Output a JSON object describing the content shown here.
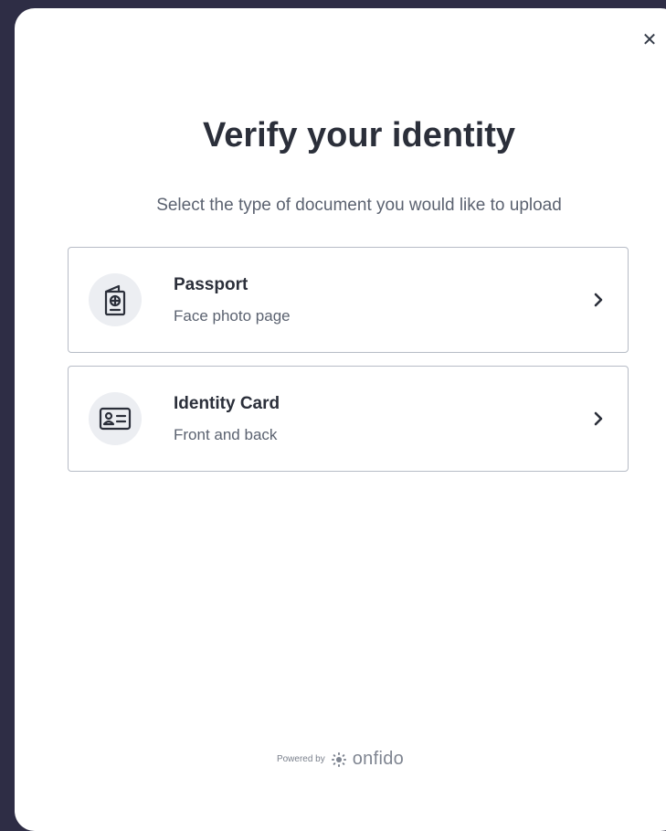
{
  "modal": {
    "title": "Verify your identity",
    "subtitle": "Select the type of document you would like to upload",
    "close_icon": "close-icon"
  },
  "documents": [
    {
      "title": "Passport",
      "subtitle": "Face photo page",
      "icon": "passport-icon"
    },
    {
      "title": "Identity Card",
      "subtitle": "Front and back",
      "icon": "id-card-icon"
    }
  ],
  "footer": {
    "powered_by": "Powered by",
    "brand": "onfido",
    "brand_icon": "onfido-logo-icon"
  },
  "colors": {
    "backdrop": "#2e2d45",
    "modal_bg": "#ffffff",
    "text_primary": "#2b2f3a",
    "text_secondary": "#5b6270",
    "border": "#b7bcc6",
    "icon_bg": "#eceef2"
  }
}
